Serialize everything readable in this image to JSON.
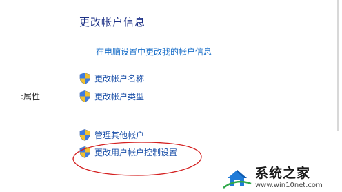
{
  "header": {
    "title": "更改帐户信息"
  },
  "links": {
    "pc_settings": "在电脑设置中更改我的帐户信息"
  },
  "side": {
    "label": ":属性"
  },
  "actions": [
    {
      "label": "更改帐户名称",
      "icon": "uac-shield-icon"
    },
    {
      "label": "更改帐户类型",
      "icon": "uac-shield-icon"
    },
    {
      "label": "管理其他帐户",
      "icon": "uac-shield-icon"
    },
    {
      "label": "更改用户帐户控制设置",
      "icon": "uac-shield-icon"
    }
  ],
  "annotation": {
    "highlight_color": "#d42020"
  },
  "watermark": {
    "name": "系统之家",
    "url": "www.win10net.com"
  }
}
